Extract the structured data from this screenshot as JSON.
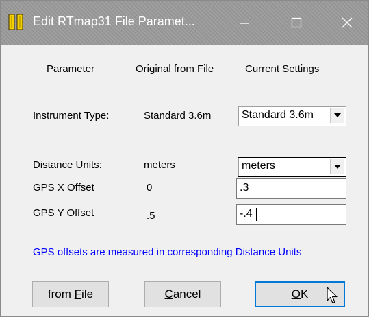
{
  "window": {
    "title": "Edit RTmap31 File Paramet...",
    "minimize": "minimize",
    "maximize": "maximize",
    "close": "close"
  },
  "headers": {
    "parameter": "Parameter",
    "original": "Original from File",
    "current": "Current Settings"
  },
  "rows": {
    "instrument": {
      "label": "Instrument Type:",
      "original": "Standard 3.6m",
      "current": "Standard 3.6m"
    },
    "distance": {
      "label": "Distance Units:",
      "original": "meters",
      "current": "meters"
    },
    "gps_x": {
      "label": "GPS X Offset",
      "original": "0",
      "current": ".3"
    },
    "gps_y": {
      "label": "GPS Y Offset",
      "original": ".5",
      "current": "-.4"
    }
  },
  "note": "GPS offsets are measured in corresponding Distance Units",
  "buttons": {
    "from_file": {
      "pre": "from ",
      "mnemonic": "F",
      "post": "ile"
    },
    "cancel": {
      "pre": "",
      "mnemonic": "C",
      "post": "ancel"
    },
    "ok": {
      "pre": "",
      "mnemonic": "O",
      "post": "K"
    }
  },
  "colors": {
    "titlebar": "#9a9a9a",
    "note": "#0000ff",
    "default_button_border": "#0078d7"
  },
  "icons": {
    "app": "app-icon",
    "dropdown": "chevron-down-icon",
    "cursor": "pointer-cursor-icon"
  }
}
